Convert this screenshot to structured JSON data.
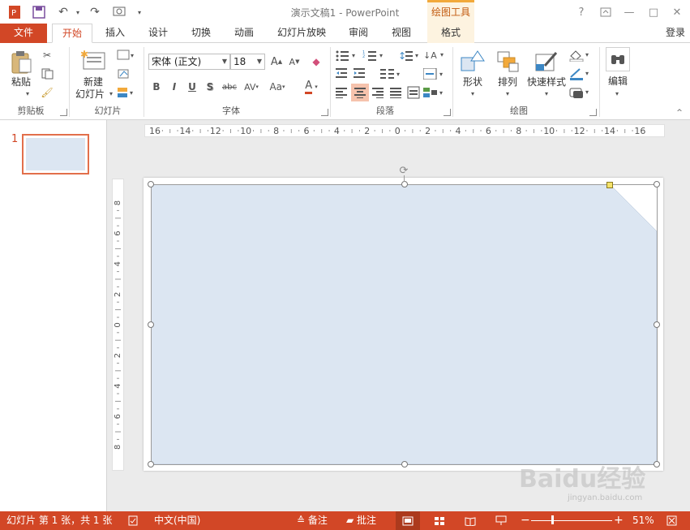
{
  "window": {
    "title": "演示文稿1 - PowerPoint",
    "context_group": "绘图工具",
    "controls": [
      "?",
      "□",
      "—",
      "□",
      "✕"
    ]
  },
  "account": {
    "signin": "登录"
  },
  "tabs": [
    {
      "label": "文件"
    },
    {
      "label": "开始"
    },
    {
      "label": "插入"
    },
    {
      "label": "设计"
    },
    {
      "label": "切换"
    },
    {
      "label": "动画"
    },
    {
      "label": "幻灯片放映"
    },
    {
      "label": "审阅"
    },
    {
      "label": "视图"
    },
    {
      "label": "格式"
    }
  ],
  "ribbon": {
    "clipboard": {
      "paste": "粘贴",
      "group": "剪贴板"
    },
    "slides": {
      "new_slide_1": "新建",
      "new_slide_2": "幻灯片",
      "group": "幻灯片"
    },
    "font": {
      "font_name": "宋体 (正文)",
      "font_size": "18",
      "group": "字体",
      "bold": "B",
      "italic": "I",
      "underline": "U",
      "shadow": "S",
      "strike": "abc",
      "spacing": "AV",
      "case": "Aa",
      "color": "A",
      "grow": "A",
      "shrink": "A"
    },
    "paragraph": {
      "group": "段落"
    },
    "drawing": {
      "shapes": "形状",
      "arrange": "排列",
      "quick_styles": "快速样式",
      "group": "绘图"
    },
    "editing": {
      "edit": "编辑"
    }
  },
  "thumbnails": [
    {
      "number": "1"
    }
  ],
  "rulers": {
    "horizontal": [
      "16",
      "14",
      "12",
      "10",
      "8",
      "6",
      "4",
      "2",
      "0",
      "2",
      "4",
      "6",
      "8",
      "10",
      "12",
      "14",
      "16"
    ],
    "vertical": [
      "8",
      "6",
      "4",
      "2",
      "0",
      "2",
      "4",
      "6",
      "8"
    ]
  },
  "statusbar": {
    "slide_info": "幻灯片 第 1 张，共 1 张",
    "language": "中文(中国)",
    "notes": "备注",
    "comments": "批注",
    "zoom": "51%",
    "zoom_level": 0.51
  },
  "watermark": {
    "brand": "Baidu经验",
    "url": "jingyan.baidu.com"
  },
  "colors": {
    "accent": "#d24726",
    "shape_fill": "#dce6f2",
    "selection": "#f6c3ad"
  }
}
